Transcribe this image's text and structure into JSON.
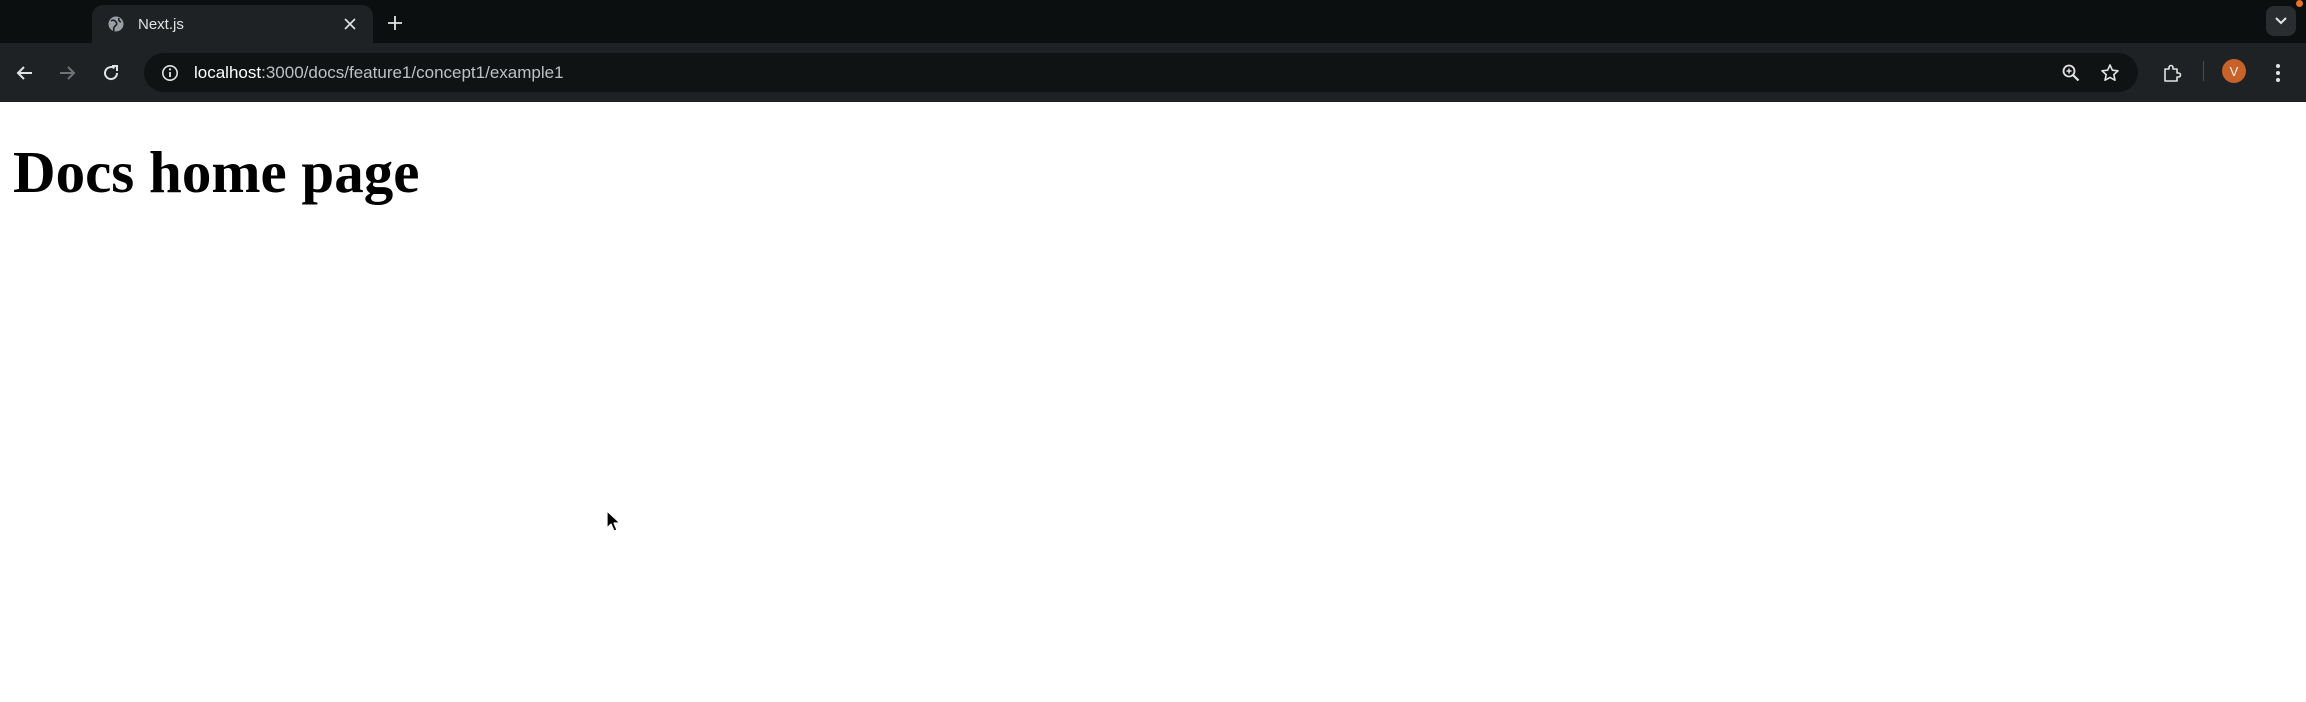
{
  "browser": {
    "tab": {
      "title": "Next.js",
      "favicon": "globe-icon"
    },
    "address_bar": {
      "host": "localhost",
      "path": ":3000/docs/feature1/concept1/example1"
    },
    "profile_initial": "V"
  },
  "page": {
    "heading": "Docs home page"
  },
  "colors": {
    "chrome_bg": "#0c0f10",
    "toolbar_bg": "#1f2224",
    "omnibox_bg": "#101314",
    "avatar_bg": "#c7622a",
    "page_bg": "#ffffff"
  }
}
